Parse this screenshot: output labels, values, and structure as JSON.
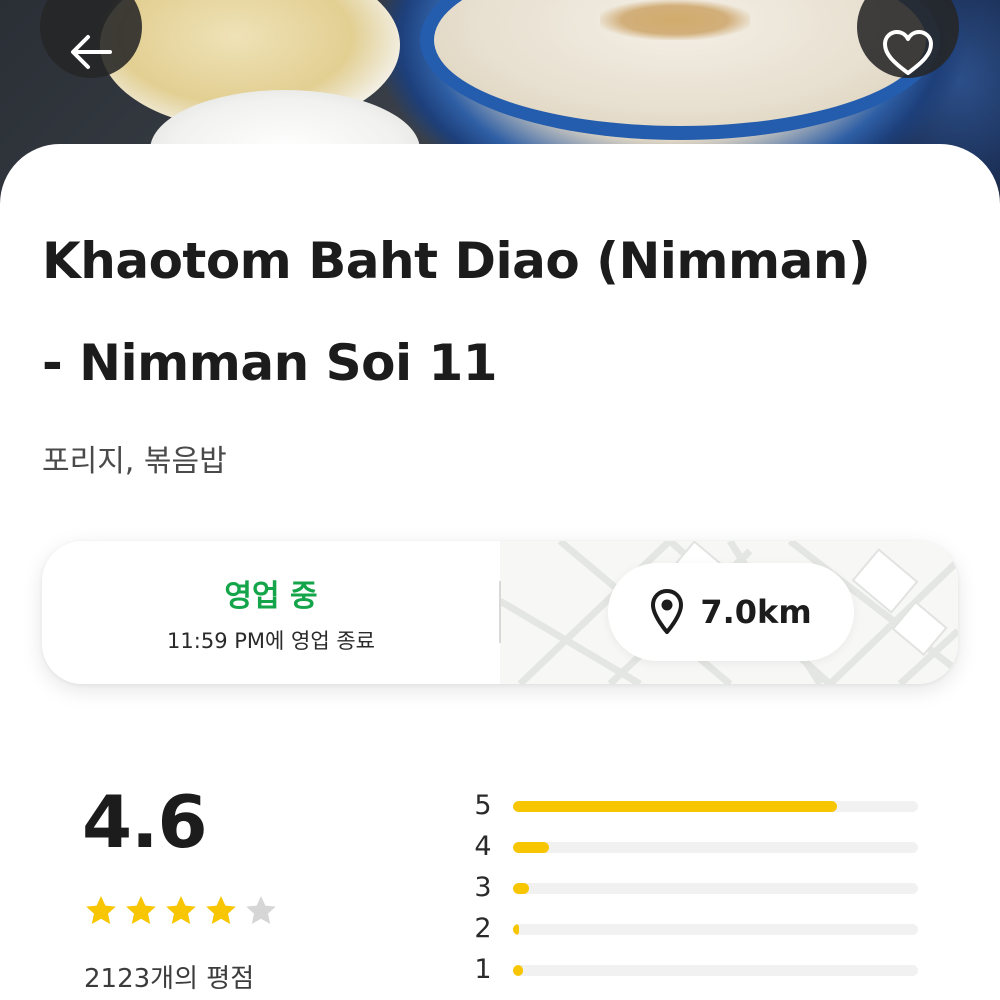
{
  "restaurant": {
    "name": "Khaotom Baht Diao (Nimman) - Nimman Soi 11",
    "cuisines": "포리지, 볶음밥"
  },
  "status": {
    "open_label": "영업 중",
    "closing_text": "11:59 PM에 영업 종료",
    "open_color": "#14a54a"
  },
  "distance": {
    "label": "7.0km",
    "icon": "location-pin-icon"
  },
  "rating": {
    "value": "4.6",
    "stars_filled": 4,
    "stars_total": 5,
    "count_text": "2123개의 평점",
    "star_color": "#f7c600",
    "distribution": [
      {
        "label": "5",
        "fraction": 0.8
      },
      {
        "label": "4",
        "fraction": 0.09
      },
      {
        "label": "3",
        "fraction": 0.04
      },
      {
        "label": "2",
        "fraction": 0.015
      },
      {
        "label": "1",
        "fraction": 0.025
      }
    ]
  },
  "actions": {
    "back_icon": "arrow-left-icon",
    "favorite_icon": "heart-icon"
  }
}
